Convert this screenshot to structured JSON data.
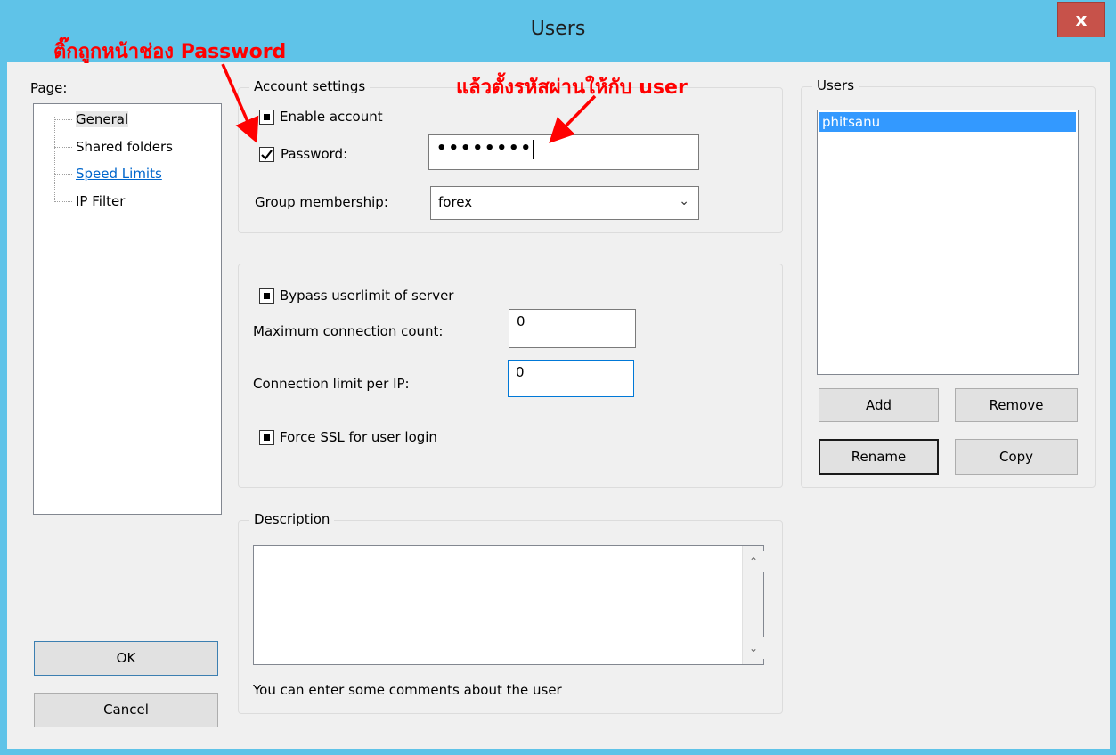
{
  "window": {
    "title": "Users",
    "close_label": "x"
  },
  "page_panel": {
    "label": "Page:",
    "items": [
      {
        "label": "General"
      },
      {
        "label": "Shared folders"
      },
      {
        "label": "Speed Limits"
      },
      {
        "label": "IP Filter"
      }
    ]
  },
  "account": {
    "group_title": "Account settings",
    "enable_label": "Enable account",
    "password_label": "Password:",
    "password_value": "••••••••",
    "group_membership_label": "Group membership:",
    "group_value": "forex"
  },
  "limits": {
    "bypass_label": "Bypass userlimit of server",
    "max_conn_label": "Maximum connection count:",
    "max_conn_value": "0",
    "conn_per_ip_label": "Connection limit per IP:",
    "conn_per_ip_value": "0",
    "force_ssl_label": "Force SSL for user login"
  },
  "description": {
    "group_title": "Description",
    "hint": "You can enter some comments about the user"
  },
  "users": {
    "group_title": "Users",
    "list": [
      "phitsanu"
    ],
    "add": "Add",
    "remove": "Remove",
    "rename": "Rename",
    "copy": "Copy"
  },
  "footer": {
    "ok": "OK",
    "cancel": "Cancel"
  },
  "annotations": {
    "password_tip_text": "ติ๊กถูกหน้าช่อง ",
    "password_tip_bold": "Password",
    "set_password_text": "แล้วตั้งรหัสผ่านให้กับ ",
    "set_password_bold": "user"
  },
  "colors": {
    "title_bar": "#5fc3e8",
    "close": "#c7524a",
    "selection": "#3399ff",
    "annotation": "#ff0000",
    "link": "#0066cc"
  }
}
